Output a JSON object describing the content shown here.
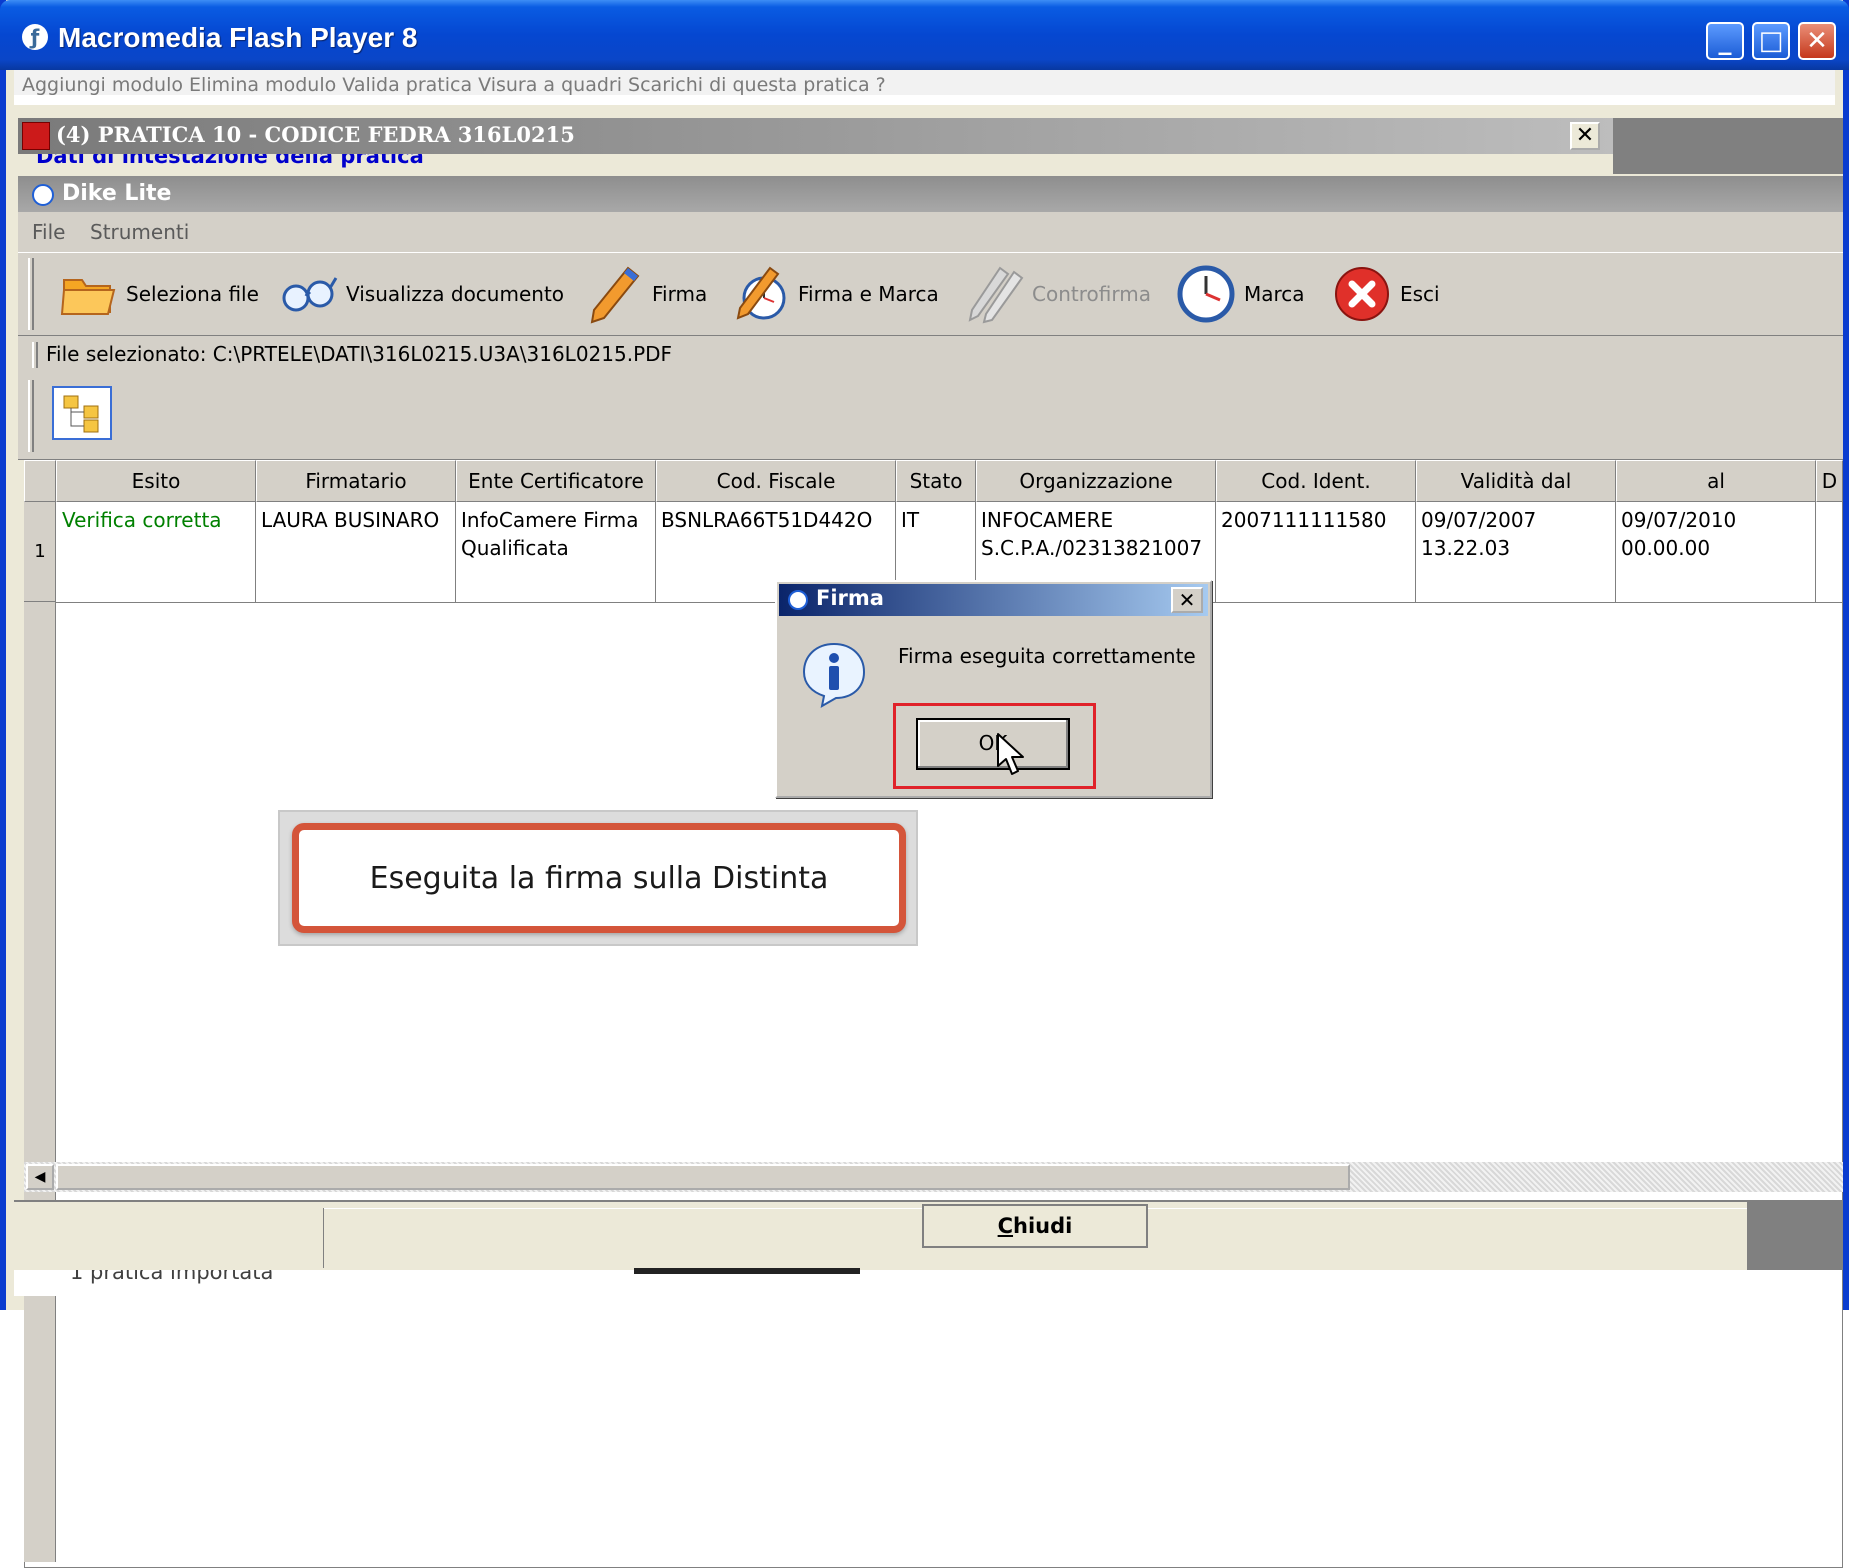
{
  "window": {
    "title": "Macromedia Flash Player 8",
    "controls": {
      "minimize_glyph": "_",
      "maximize_glyph": "□",
      "close_glyph": "✕"
    }
  },
  "flash_menu": {
    "items_text": "Aggiungi modulo    Elimina modulo    Valida pratica    Visura a quadri    Scarichi di questa pratica    ?"
  },
  "pratica": {
    "title": "(4) PRATICA 10 - CODICE FEDRA 316L0215",
    "subtitle": "Dati di intestazione della pratica",
    "close_glyph": "✕"
  },
  "dike": {
    "title": "Dike Lite",
    "menu": [
      "File",
      "Strumenti"
    ],
    "toolbar": [
      {
        "label": "Seleziona file",
        "icon": "folder-icon",
        "enabled": true
      },
      {
        "label": "Visualizza documento",
        "icon": "glasses-icon",
        "enabled": true
      },
      {
        "label": "Firma",
        "icon": "pen-icon",
        "enabled": true
      },
      {
        "label": "Firma e Marca",
        "icon": "pen-clock-icon",
        "enabled": true
      },
      {
        "label": "Controfirma",
        "icon": "double-pen-icon",
        "enabled": false
      },
      {
        "label": "Marca",
        "icon": "clock-icon",
        "enabled": true
      },
      {
        "label": "Esci",
        "icon": "exit-icon",
        "enabled": true
      }
    ],
    "selected_file": "File selezionato: C:\\PRTELE\\DATI\\316L0215.U3A\\316L0215.PDF"
  },
  "grid": {
    "columns": [
      "Esito",
      "Firmatario",
      "Ente Certificatore",
      "Cod. Fiscale",
      "Stato",
      "Organizzazione",
      "Cod. Ident.",
      "Validità dal",
      "al",
      "D"
    ],
    "rows": [
      {
        "num": "1",
        "esito": "Verifica corretta",
        "firmatario": "LAURA BUSINARO",
        "ente": "InfoCamere Firma Qualificata",
        "cod_fiscale": "BSNLRA66T51D442O",
        "stato": "IT",
        "organizzazione": "INFOCAMERE S.C.P.A./02313821007",
        "cod_ident": "2007111111580",
        "validita_dal": "09/07/2007 13.22.03",
        "al": "09/07/2010 00.00.00"
      }
    ],
    "esito_color": "#008000",
    "scroll_left_glyph": "◀"
  },
  "bottom": {
    "close_label_first": "C",
    "close_label_rest": "hiudi",
    "footer_text": "1    pratica importata"
  },
  "dialog": {
    "title": "Firma",
    "message": "Firma eseguita correttamente",
    "ok_label": "OK",
    "close_glyph": "✕",
    "highlight_color": "#e0222a"
  },
  "callout": {
    "text": "Eseguita la firma sulla Distinta",
    "border_color": "#d4553a"
  }
}
